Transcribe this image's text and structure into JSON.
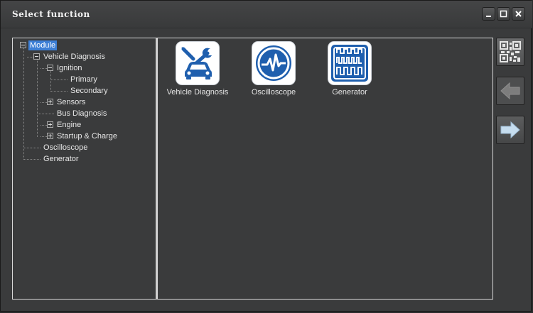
{
  "window": {
    "title": "Select function"
  },
  "tree": {
    "root": "Module",
    "vehicle_diagnosis": "Vehicle Diagnosis",
    "ignition": "Ignition",
    "primary": "Primary",
    "secondary": "Secondary",
    "sensors": "Sensors",
    "bus_diagnosis": "Bus Diagnosis",
    "engine": "Engine",
    "startup_charge": "Startup & Charge",
    "oscilloscope": "Oscilloscope",
    "generator": "Generator"
  },
  "apps": [
    {
      "label": "Vehicle Diagnosis",
      "icon": "vehicle-diagnosis-icon"
    },
    {
      "label": "Oscilloscope",
      "icon": "oscilloscope-icon"
    },
    {
      "label": "Generator",
      "icon": "generator-icon"
    }
  ],
  "side_buttons": {
    "qr": "qr-code-icon",
    "back": "arrow-left-icon",
    "forward": "arrow-right-icon"
  },
  "colors": {
    "accent_blue": "#1f5fae",
    "selection": "#3d7fd6",
    "background": "#3a3b3c",
    "forward_arrow": "#c6ddef",
    "back_arrow_disabled": "#7d7d7d"
  }
}
